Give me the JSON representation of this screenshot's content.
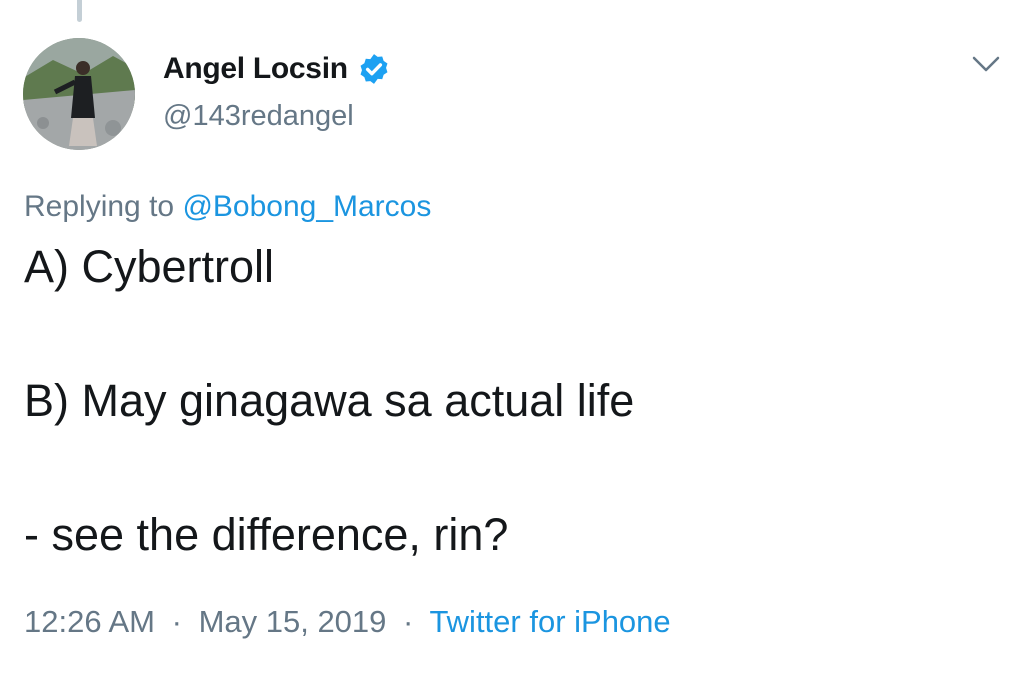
{
  "tweet": {
    "author": {
      "display_name": "Angel Locsin",
      "handle": "@143redangel",
      "verified": true,
      "avatar_icon": "profile-photo"
    },
    "reply": {
      "prefix": "Replying to",
      "mention": "@Bobong_Marcos"
    },
    "text_lines": [
      "A) Cybertroll",
      "B) May ginagawa sa actual life",
      "- see the difference, rin?"
    ],
    "meta": {
      "time": "12:26 AM",
      "date": "May 15, 2019",
      "separator": "·",
      "source": "Twitter for iPhone"
    },
    "icons": {
      "verified": "verified-badge-icon",
      "menu": "chevron-down-icon"
    },
    "colors": {
      "text": "#14171a",
      "secondary": "#657786",
      "link": "#1b95e0",
      "verified": "#1da1f2"
    }
  }
}
